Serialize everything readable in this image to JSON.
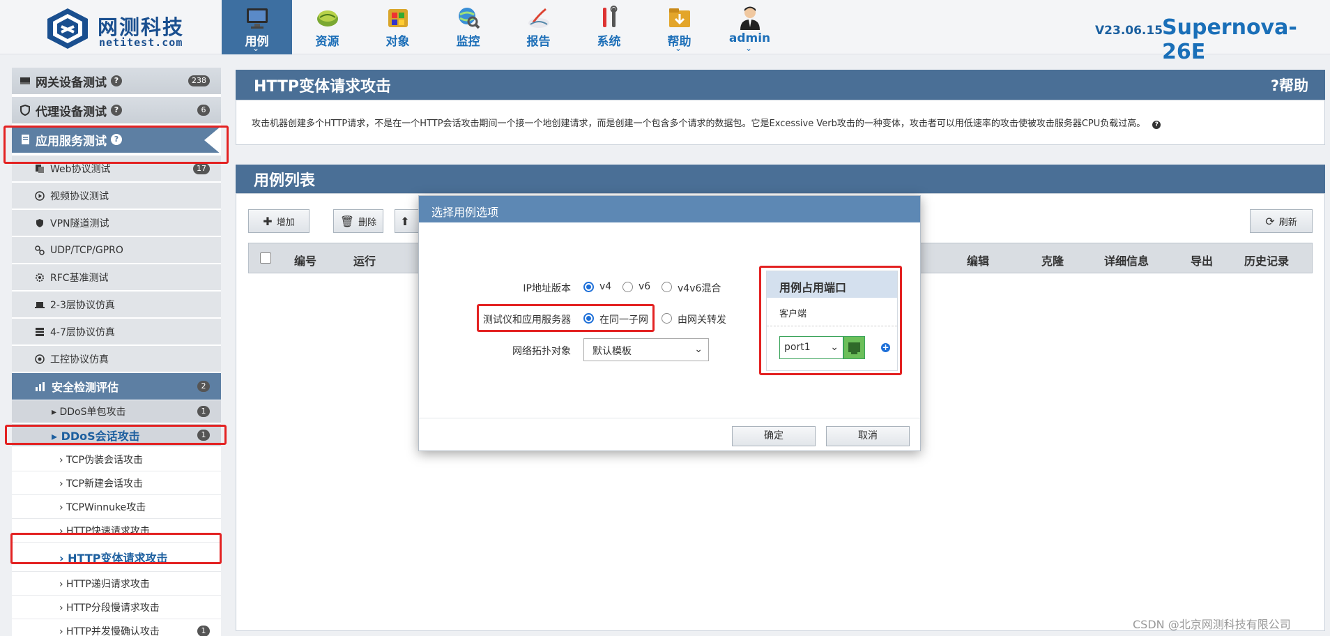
{
  "header": {
    "logo_cn": "网测科技",
    "logo_en": "netitest.com",
    "version": "V23.06.15",
    "product": "Supernova-26E",
    "nav": [
      {
        "label": "用例",
        "icon": "monitor-icon",
        "active": true,
        "caret": true
      },
      {
        "label": "资源",
        "icon": "resource-icon",
        "active": false,
        "caret": false
      },
      {
        "label": "对象",
        "icon": "object-icon",
        "active": false,
        "caret": false
      },
      {
        "label": "监控",
        "icon": "monitor-globe-icon",
        "active": false,
        "caret": false
      },
      {
        "label": "报告",
        "icon": "report-icon",
        "active": false,
        "caret": false
      },
      {
        "label": "系统",
        "icon": "tools-icon",
        "active": false,
        "caret": false
      },
      {
        "label": "帮助",
        "icon": "help-folder-icon",
        "active": false,
        "caret": true
      },
      {
        "label": "admin",
        "icon": "user-icon",
        "active": false,
        "caret": true
      }
    ]
  },
  "sidebar": {
    "top": [
      {
        "label": "网关设备测试",
        "badge": "238"
      },
      {
        "label": "代理设备测试",
        "badge": "6"
      },
      {
        "label": "应用服务测试",
        "badge": ""
      }
    ],
    "sub": [
      {
        "label": "Web协议测试",
        "badge": "17"
      },
      {
        "label": "视频协议测试",
        "badge": ""
      },
      {
        "label": "VPN隧道测试",
        "badge": ""
      },
      {
        "label": "UDP/TCP/GPRO",
        "badge": ""
      },
      {
        "label": "RFC基准测试",
        "badge": ""
      },
      {
        "label": "2-3层协议仿真",
        "badge": ""
      },
      {
        "label": "4-7层协议仿真",
        "badge": ""
      },
      {
        "label": "工控协议仿真",
        "badge": ""
      }
    ],
    "group": {
      "label": "安全检测评估",
      "badge": "2"
    },
    "l3": [
      {
        "label": "▸ DDoS单包攻击",
        "badge": "1"
      },
      {
        "label": "▸ DDoS会话攻击",
        "badge": "1"
      }
    ],
    "l4": [
      {
        "label": "› TCP伪装会话攻击",
        "badge": ""
      },
      {
        "label": "› TCP新建会话攻击",
        "badge": ""
      },
      {
        "label": "› TCPWinnuke攻击",
        "badge": ""
      },
      {
        "label": "› HTTP快速请求攻击",
        "badge": ""
      },
      {
        "label": "› HTTP变体请求攻击",
        "badge": ""
      },
      {
        "label": "› HTTP递归请求攻击",
        "badge": ""
      },
      {
        "label": "› HTTP分段慢请求攻击",
        "badge": ""
      },
      {
        "label": "› HTTP并发慢确认攻击",
        "badge": "1"
      }
    ]
  },
  "desc_panel": {
    "title": "HTTP变体请求攻击",
    "help": "帮助",
    "text": "攻击机器创建多个HTTP请求，不是在一个HTTP会话攻击期间一个接一个地创建请求，而是创建一个包含多个请求的数据包。它是Excessive Verb攻击的一种变体，攻击者可以用低速率的攻击使被攻击服务器CPU负载过高。"
  },
  "list_panel": {
    "title": "用例列表",
    "buttons": {
      "add": "增加",
      "delete": "删除",
      "refresh": "刷新"
    },
    "columns_left": [
      "编号",
      "运行"
    ],
    "columns_right": [
      "编辑",
      "克隆",
      "详细信息",
      "导出",
      "历史记录"
    ]
  },
  "modal": {
    "title": "选择用例选项",
    "ip_label": "IP地址版本",
    "ip_options": [
      "v4",
      "v6",
      "v4v6混合"
    ],
    "ip_selected": "v4",
    "topo_label": "测试仪和应用服务器",
    "topo_options": [
      "在同一子网",
      "由网关转发"
    ],
    "topo_selected": "在同一子网",
    "net_label": "网络拓扑对象",
    "net_value": "默认模板",
    "port_title": "用例占用端口",
    "port_client": "客户端",
    "port_value": "port1",
    "ok": "确定",
    "cancel": "取消"
  },
  "watermark": "CSDN @北京网测科技有限公司",
  "colors": {
    "accent": "#3d6fa1",
    "modal_header": "#5d88b4",
    "highlight": "#e32222",
    "link": "#1d6fb8"
  }
}
